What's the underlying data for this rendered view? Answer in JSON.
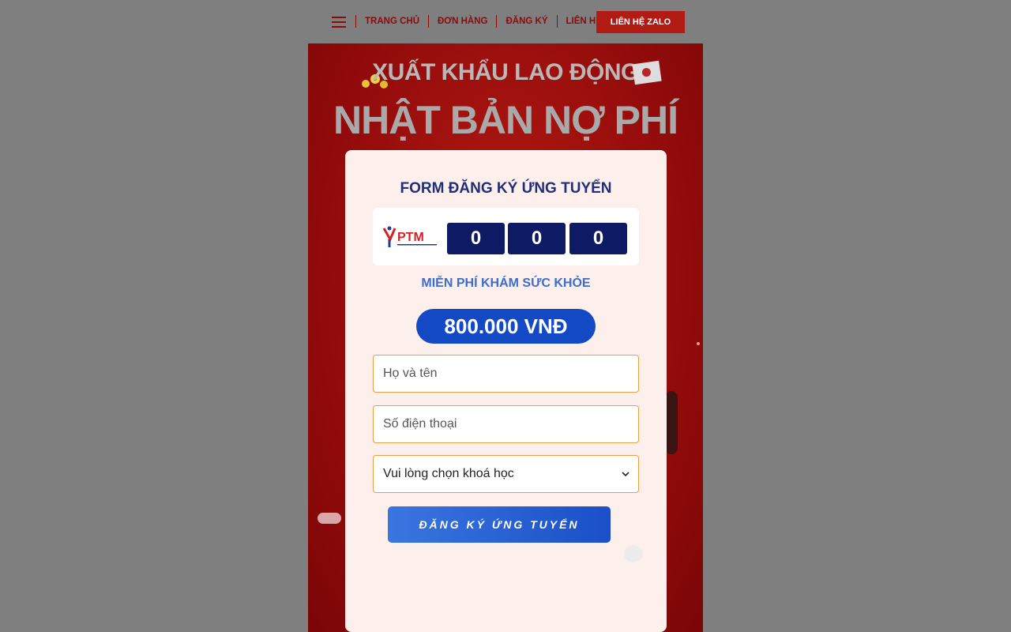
{
  "nav": {
    "links": [
      "TRANG CHỦ",
      "ĐƠN HÀNG",
      "ĐĂNG KÝ",
      "LIÊN HỆ"
    ],
    "zalo_button": "LIÊN HỆ ZALO"
  },
  "banner": {
    "headline1": "XUẤT KHẨU LAO ĐỘNG",
    "headline2": "NHẬT BẢN NỢ PHÍ"
  },
  "form": {
    "title": "FORM ĐĂNG KÝ ỨNG TUYỂN",
    "logo_text": "PTM",
    "counter": [
      "0",
      "0",
      "0"
    ],
    "promo": "MIỄN PHÍ KHÁM SỨC KHỎE",
    "price": "800.000 VNĐ",
    "name_placeholder": "Họ và tên",
    "phone_placeholder": "Số điện thoại",
    "course_select": "Vui lòng chọn khoá học",
    "submit_label": "ĐĂNG KÝ ỨNG TUYỂN"
  },
  "colors": {
    "nav_text": "#8b0a0a",
    "banner_red": "#b41a14",
    "card_bg": "#fdefeb",
    "title_navy": "#1f2f7a",
    "counter_navy": "#0e1a63",
    "price_blue": "#1449c6",
    "field_border": "#e6a042"
  }
}
